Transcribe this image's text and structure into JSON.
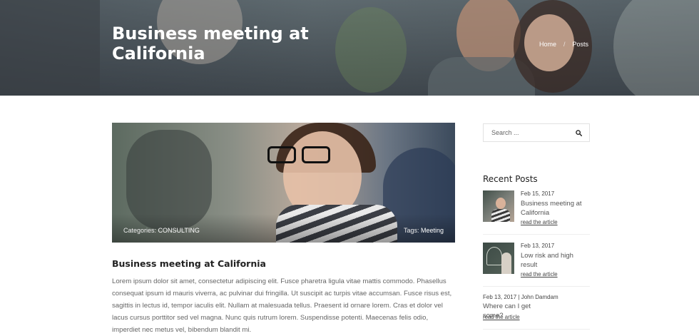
{
  "hero": {
    "title": "Business meeting at California",
    "breadcrumbs": [
      "Home",
      "Posts"
    ],
    "breadcrumb_separator": "/"
  },
  "article": {
    "categories_label": "Categories:",
    "category": "CONSULTING",
    "tags_label": "Tags:",
    "tag": "Meeting",
    "title": "Business meeting at California",
    "body": "Lorem ipsum dolor sit amet, consectetur adipiscing elit. Fusce pharetra ligula vitae mattis commodo. Phasellus consequat ipsum id mauris viverra, ac pulvinar dui fringilla. Ut suscipit ac turpis vitae accumsan. Fusce risus est, sagittis in lectus id, tempor iaculis elit. Nullam at malesuada tellus. Praesent id ornare lorem. Cras et dolor vel lacus cursus porttitor sed vel magna. Nunc quis rutrum lorem. Suspendisse potenti. Maecenas felis odio, imperdiet nec metus vel, bibendum blandit mi."
  },
  "sidebar": {
    "search": {
      "placeholder": "Search ...",
      "icon": "search-icon"
    },
    "recent_title": "Recent Posts",
    "posts": [
      {
        "date": "Feb 15, 2017",
        "title": "Business meeting at California",
        "link": "read the article"
      },
      {
        "date": "Feb 13, 2017",
        "title": "Low risk and high result",
        "link": "read the article"
      },
      {
        "date": "Feb 13, 2017",
        "author": "| John Damdam",
        "title": "Where can I get some?",
        "link": "read the article"
      }
    ]
  },
  "colors": {
    "text_dark": "#222222",
    "text_body": "#666666",
    "border": "#e2e2e2"
  }
}
